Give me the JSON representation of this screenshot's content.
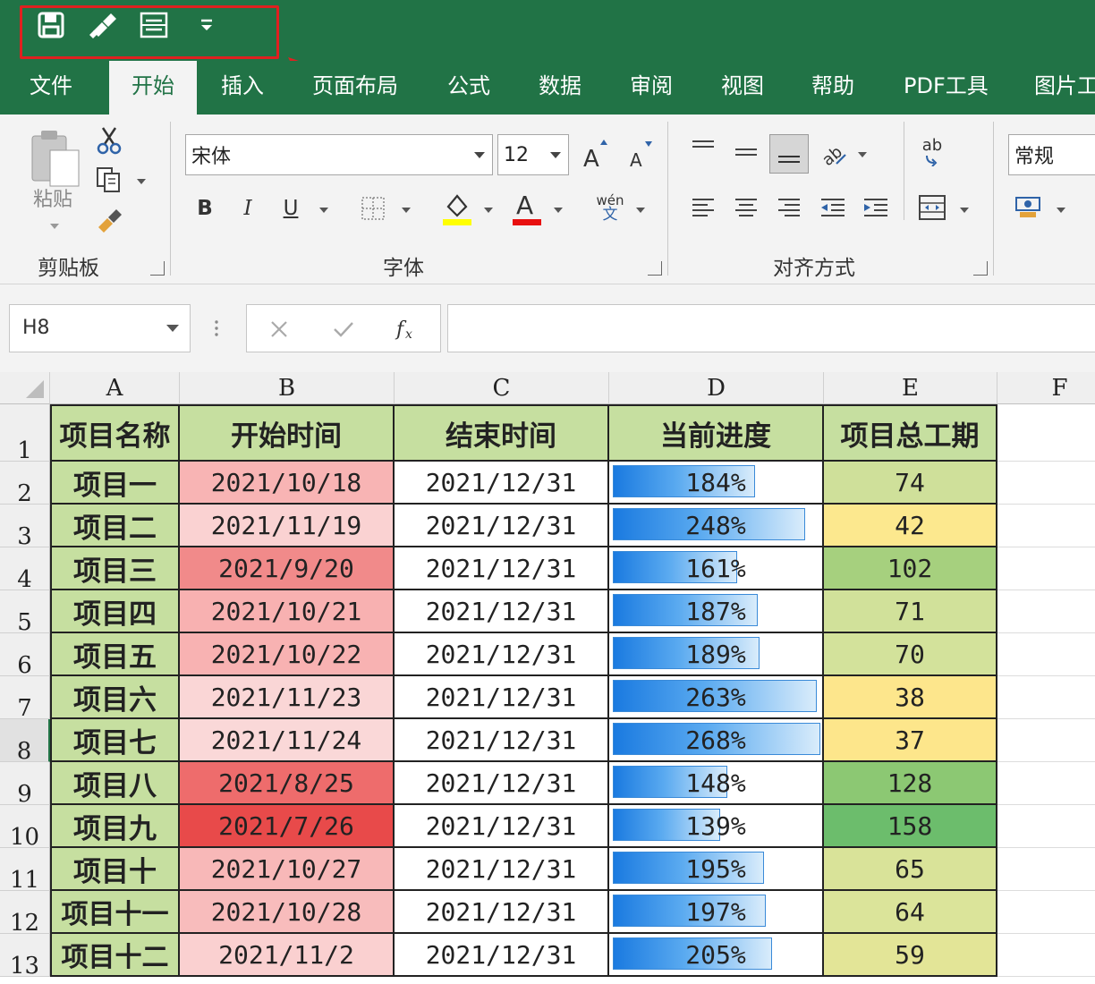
{
  "quick_access": {
    "icons": [
      "save-icon",
      "format-painter-icon",
      "page-layout-icon",
      "customize-dropdown-icon"
    ]
  },
  "tabs": [
    {
      "label": "文件",
      "active": false
    },
    {
      "label": "开始",
      "active": true
    },
    {
      "label": "插入",
      "active": false
    },
    {
      "label": "页面布局",
      "active": false
    },
    {
      "label": "公式",
      "active": false
    },
    {
      "label": "数据",
      "active": false
    },
    {
      "label": "审阅",
      "active": false
    },
    {
      "label": "视图",
      "active": false
    },
    {
      "label": "帮助",
      "active": false
    },
    {
      "label": "PDF工具",
      "active": false
    },
    {
      "label": "图片工",
      "active": false
    }
  ],
  "ribbon": {
    "clipboard": {
      "paste_label": "粘贴",
      "group_label": "剪贴板"
    },
    "font": {
      "font_name": "宋体",
      "font_size": "12",
      "group_label": "字体",
      "bold": "B",
      "italic": "I",
      "underline": "U",
      "wen_top": "wén",
      "wen_bottom": "文"
    },
    "alignment": {
      "group_label": "对齐方式",
      "wrap_label": "ab"
    },
    "number": {
      "format": "常规"
    }
  },
  "formula_bar": {
    "name_box": "H8",
    "formula": ""
  },
  "sheet": {
    "columns": [
      "A",
      "B",
      "C",
      "D",
      "E",
      "F"
    ],
    "row_numbers": [
      "1",
      "2",
      "3",
      "4",
      "5",
      "6",
      "7",
      "8",
      "9",
      "10",
      "11",
      "12",
      "13"
    ],
    "selected_row": "8",
    "headers": [
      "项目名称",
      "开始时间",
      "结束时间",
      "当前进度",
      "项目总工期"
    ],
    "rows": [
      {
        "name": "项目一",
        "start": "2021/10/18",
        "end": "2021/12/31",
        "progress": "184%",
        "duration": "74"
      },
      {
        "name": "项目二",
        "start": "2021/11/19",
        "end": "2021/12/31",
        "progress": "248%",
        "duration": "42"
      },
      {
        "name": "项目三",
        "start": "2021/9/20",
        "end": "2021/12/31",
        "progress": "161%",
        "duration": "102"
      },
      {
        "name": "项目四",
        "start": "2021/10/21",
        "end": "2021/12/31",
        "progress": "187%",
        "duration": "71"
      },
      {
        "name": "项目五",
        "start": "2021/10/22",
        "end": "2021/12/31",
        "progress": "189%",
        "duration": "70"
      },
      {
        "name": "项目六",
        "start": "2021/11/23",
        "end": "2021/12/31",
        "progress": "263%",
        "duration": "38"
      },
      {
        "name": "项目七",
        "start": "2021/11/24",
        "end": "2021/12/31",
        "progress": "268%",
        "duration": "37"
      },
      {
        "name": "项目八",
        "start": "2021/8/25",
        "end": "2021/12/31",
        "progress": "148%",
        "duration": "128"
      },
      {
        "name": "项目九",
        "start": "2021/7/26",
        "end": "2021/12/31",
        "progress": "139%",
        "duration": "158"
      },
      {
        "name": "项目十",
        "start": "2021/10/27",
        "end": "2021/12/31",
        "progress": "195%",
        "duration": "65"
      },
      {
        "name": "项目十一",
        "start": "2021/10/28",
        "end": "2021/12/31",
        "progress": "197%",
        "duration": "64"
      },
      {
        "name": "项目十二",
        "start": "2021/11/2",
        "end": "2021/12/31",
        "progress": "205%",
        "duration": "59"
      }
    ],
    "start_colors": [
      "#f8b4b4",
      "#fad2d2",
      "#f18a8a",
      "#f8b1b1",
      "#f8b2b2",
      "#fad6d6",
      "#fad8d8",
      "#ee6c6c",
      "#e84a4a",
      "#f8b8b8",
      "#f8bcbc",
      "#fad0d0"
    ],
    "duration_colors": [
      "#cfe09a",
      "#fce88e",
      "#a6d07e",
      "#d1e19a",
      "#d3e29b",
      "#fde68c",
      "#fde68b",
      "#8cc873",
      "#6cbd6c",
      "#d9e399",
      "#dbe49a",
      "#e3e597"
    ],
    "colors": {
      "excel_green": "#217346",
      "header_fill": "#c6dfa0",
      "highlight_red": "#e02020",
      "bar_blue": "#1a7ae0"
    }
  }
}
